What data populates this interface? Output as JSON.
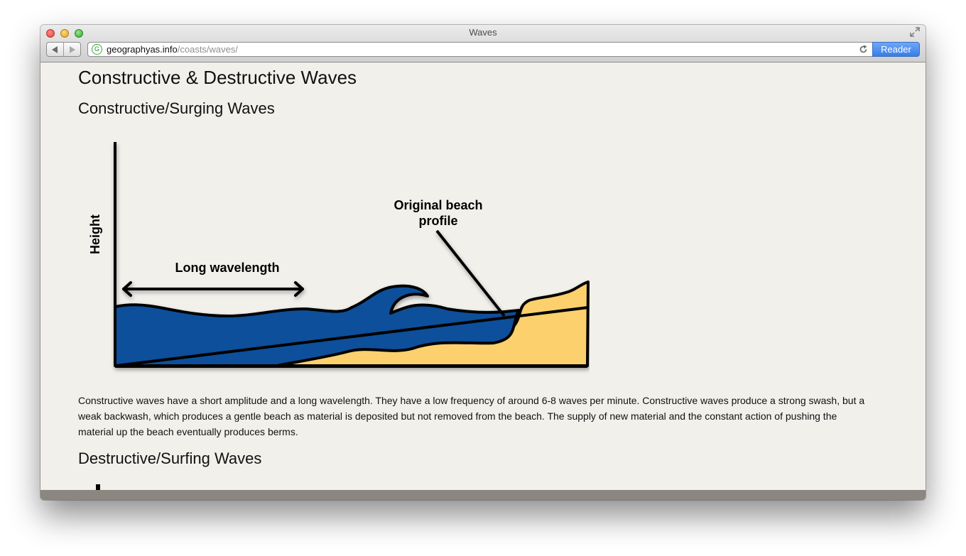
{
  "browser": {
    "title": "Waves",
    "url_host": "geographyas.info",
    "url_path": "/coasts/waves/",
    "reader_label": "Reader",
    "site_icon_glyph": "G"
  },
  "page": {
    "heading": "Constructive & Destructive Waves",
    "section1_title": "Constructive/Surging Waves",
    "section1_text": "Constructive waves have a short amplitude and a long wavelength. They have a low frequency of around 6-8 waves per minute. Constructive waves produce a strong swash, but a weak backwash, which produces a gentle beach as material is deposited but not removed from the beach. The supply of new material and the constant action of pushing the material up the beach eventually produces berms.",
    "section2_title": "Destructive/Surfing Waves"
  },
  "diagram": {
    "y_axis_label": "Height",
    "wavelength_label": "Long wavelength",
    "beach_label_line1": "Original beach",
    "beach_label_line2": "profile",
    "colors": {
      "sea": "#0b4f9a",
      "sand": "#fcd06d",
      "outline": "#000000"
    }
  }
}
